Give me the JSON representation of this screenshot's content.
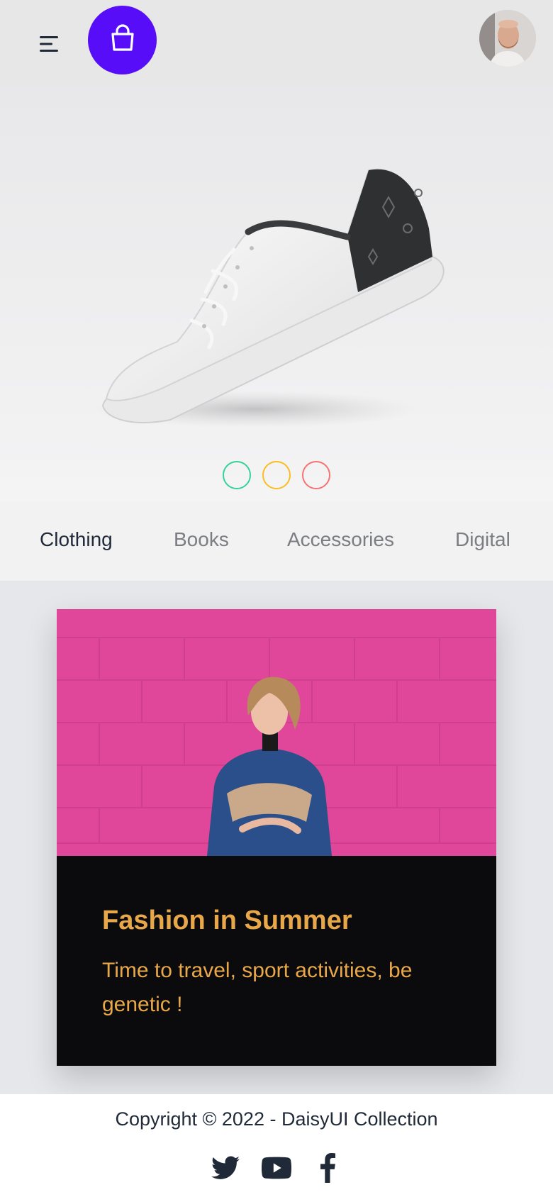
{
  "navbar": {
    "menu_icon": "hamburger-menu-icon",
    "brand_icon": "shopping-bag-icon",
    "brand_color": "#570df8",
    "avatar": "user-avatar"
  },
  "hero": {
    "image": "white-sneaker-product-photo",
    "indicators": [
      {
        "color": "#36d399"
      },
      {
        "color": "#fbbd23"
      },
      {
        "color": "#f87272"
      }
    ]
  },
  "tabs": [
    {
      "label": "Clothing",
      "active": true
    },
    {
      "label": "Books",
      "active": false
    },
    {
      "label": "Accessories",
      "active": false
    },
    {
      "label": "Digital",
      "active": false
    }
  ],
  "card": {
    "image": "woman-against-pink-wall-photo",
    "title": "Fashion in Summer",
    "text": "Time to travel, sport activities, be genetic !",
    "text_color": "#e8a84a",
    "background": "#0b0b0d"
  },
  "footer": {
    "copyright": "Copyright © 2022 - DaisyUI Collection",
    "social": [
      "twitter-icon",
      "youtube-icon",
      "facebook-icon"
    ]
  }
}
